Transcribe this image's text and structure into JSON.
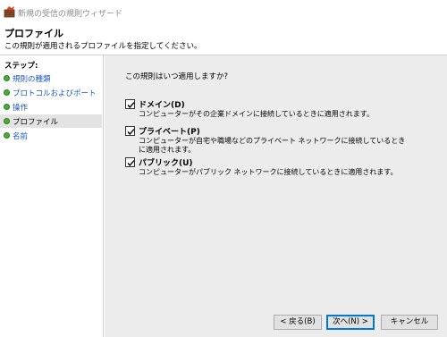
{
  "window": {
    "title": "新規の受信の規則ウィザード"
  },
  "header": {
    "title": "プロファイル",
    "subtitle": "この規則が適用されるプロファイルを指定してください。"
  },
  "steps": {
    "heading": "ステップ:",
    "items": [
      {
        "label": "規則の種類"
      },
      {
        "label": "プロトコルおよびポート"
      },
      {
        "label": "操作"
      },
      {
        "label": "プロファイル"
      },
      {
        "label": "名前"
      }
    ]
  },
  "content": {
    "question": "この規則はいつ適用しますか?",
    "options": [
      {
        "title": "ドメイン(D)",
        "description": "コンピューターがその企業ドメインに接続しているときに適用されます。",
        "checked": true
      },
      {
        "title": "プライベート(P)",
        "description": "コンピューターが自宅や職場などのプライベート ネットワークに接続しているときに適用されます。",
        "checked": true
      },
      {
        "title": "パブリック(U)",
        "description": "コンピューターがパブリック ネットワークに接続しているときに適用されます。",
        "checked": true
      }
    ]
  },
  "buttons": {
    "back": "< 戻る(B)",
    "next": "次へ(N) >",
    "cancel": "キャンセル"
  },
  "colors": {
    "step_link": "#1a56c4",
    "step_dot": "#4cab3a",
    "content_bg": "#ececec",
    "default_button_border": "#0078d7"
  },
  "icons": {
    "app": "firewall-wizard-icon",
    "step": "green-dot-icon",
    "checkbox": "checkmark-icon"
  }
}
